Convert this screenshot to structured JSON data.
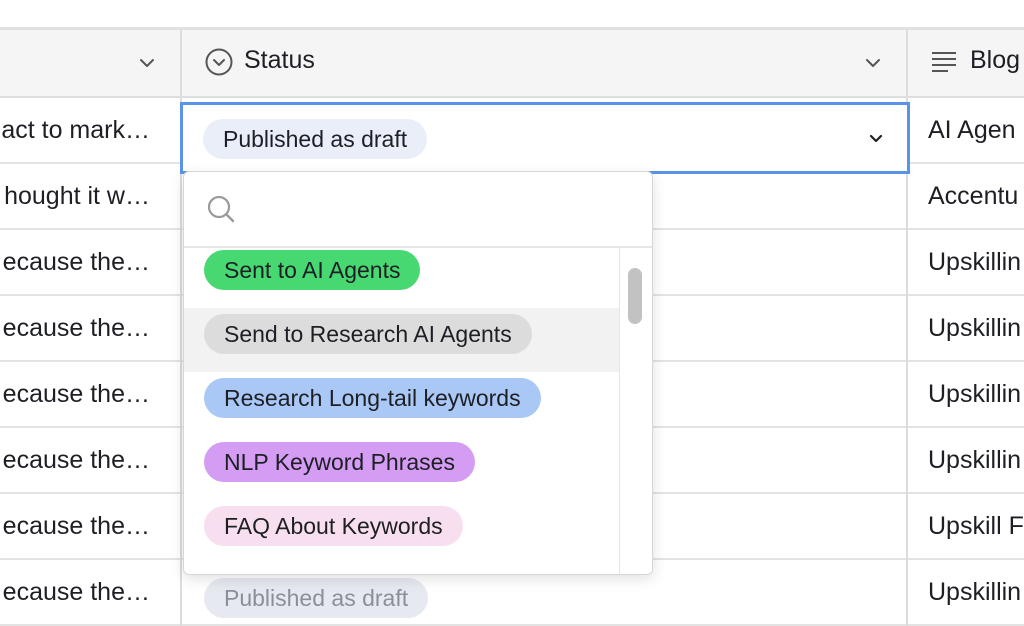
{
  "header": {
    "status_label": "Status",
    "blog_label": "Blog"
  },
  "rows": [
    {
      "col1": "act to mark…",
      "col3": "AI Agen"
    },
    {
      "col1": "hought it w…",
      "col3": "Accentu"
    },
    {
      "col1": "ecause the…",
      "col3": "Upskillin"
    },
    {
      "col1": "ecause the…",
      "col3": "Upskillin"
    },
    {
      "col1": "ecause the…",
      "col3": "Upskillin"
    },
    {
      "col1": "ecause the…",
      "col3": "Upskillin"
    },
    {
      "col1": "ecause the…",
      "col3": "Upskill F"
    },
    {
      "col1": "ecause the…",
      "col3": "Upskillin"
    }
  ],
  "active_cell": {
    "value": "Published as draft",
    "color": "#e9eef8"
  },
  "ghost_pill": "Published as draft",
  "dropdown": {
    "search_placeholder": "",
    "options": [
      {
        "label": "Sent to AI Agents",
        "color": "#47d872"
      },
      {
        "label": "Send to Research AI Agents",
        "color": "#dcdcdc"
      },
      {
        "label": "Research Long-tail keywords",
        "color": "#a9c8f6"
      },
      {
        "label": "NLP Keyword Phrases",
        "color": "#d49cf2"
      },
      {
        "label": "FAQ About Keywords",
        "color": "#f8dff0"
      }
    ]
  },
  "colors": {
    "accent": "#5b93e8"
  }
}
